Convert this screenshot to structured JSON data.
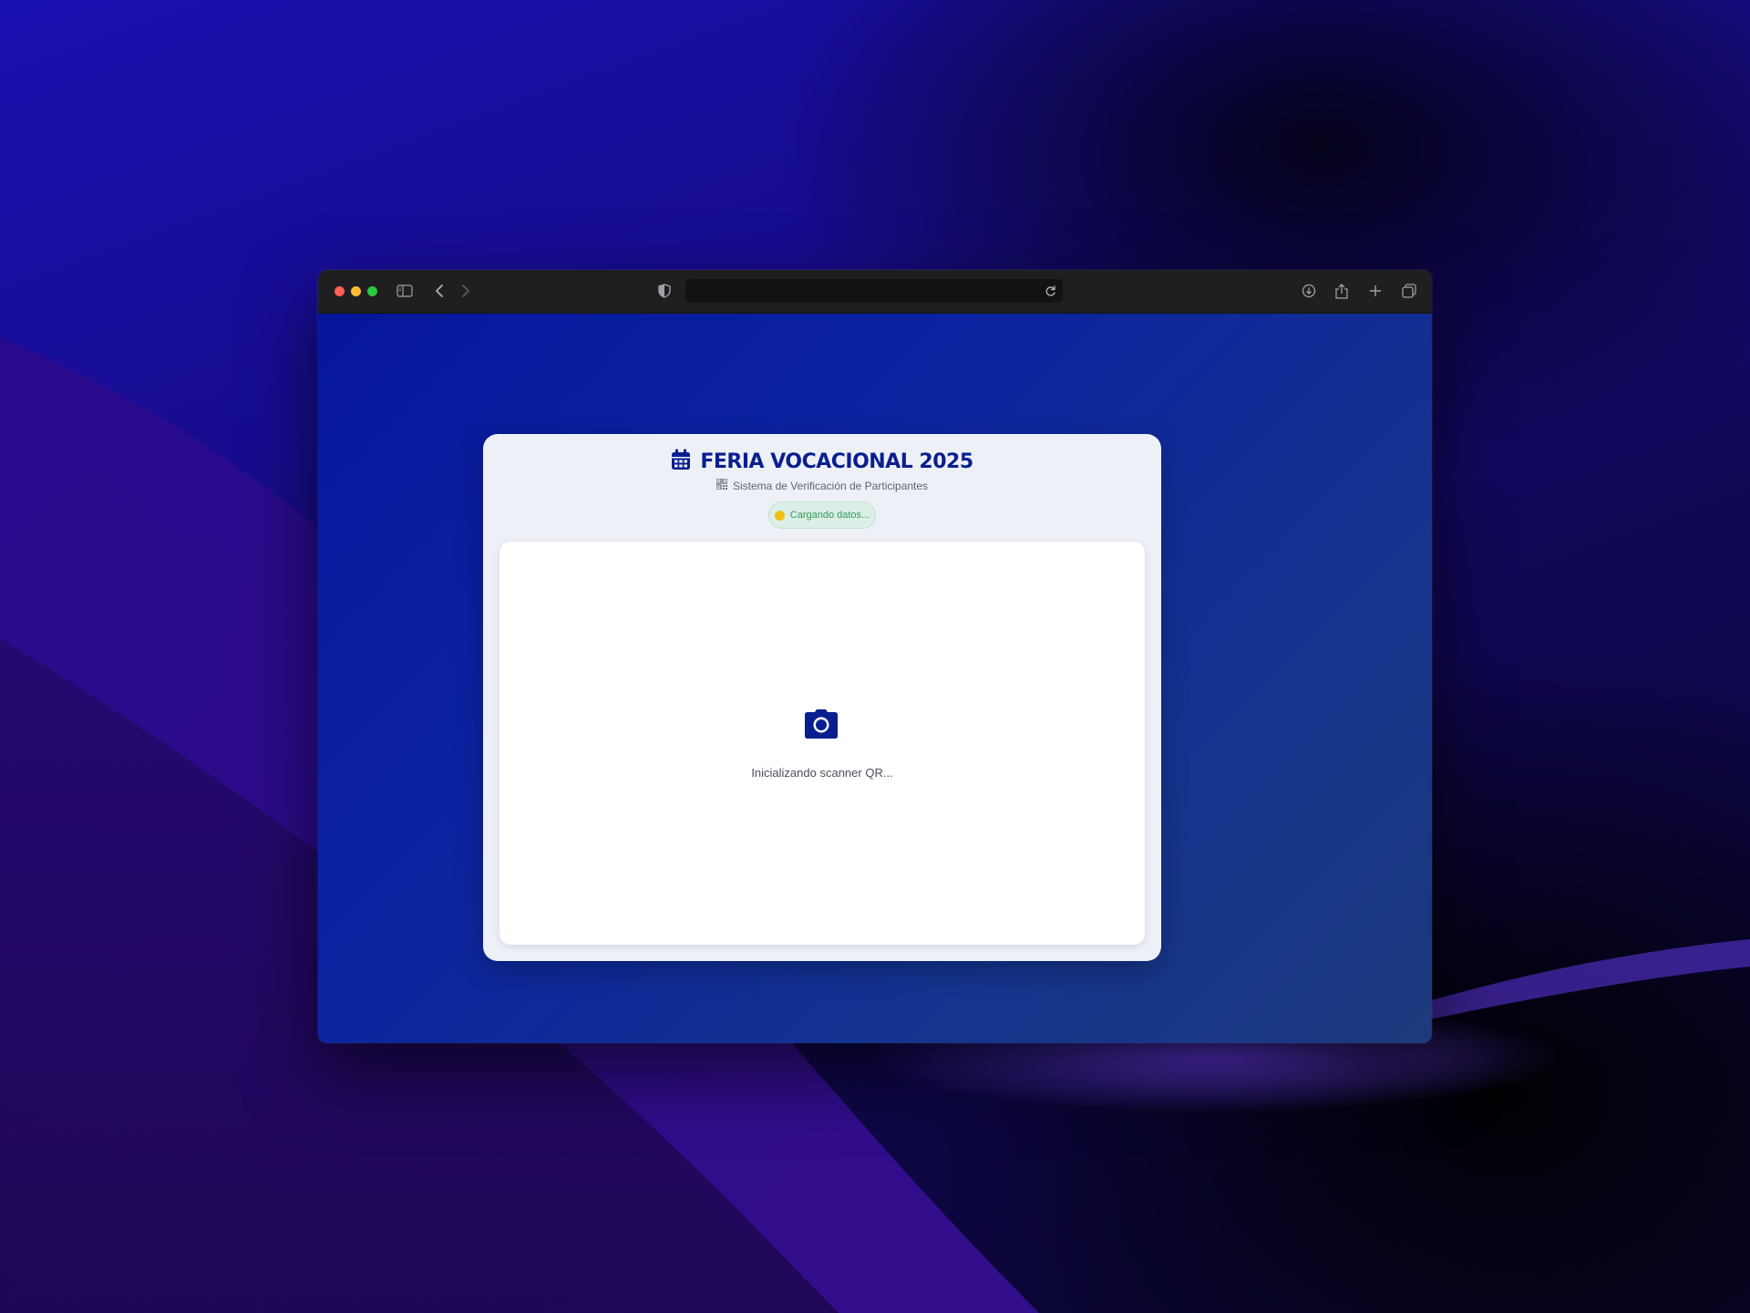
{
  "browser": {
    "address": "",
    "icons": {
      "sidebar": "sidebar-icon",
      "back": "chevron-left-icon",
      "forward": "chevron-right-icon",
      "privacy": "shield-icon",
      "reload": "reload-icon",
      "download": "download-icon",
      "share": "share-icon",
      "new_tab": "plus-icon",
      "tabs": "tab-overview-icon"
    }
  },
  "app": {
    "title": "FERIA VOCACIONAL 2025",
    "subtitle": "Sistema de Verificación de Participantes",
    "status": "Cargando datos...",
    "scanner_message": "Inicializando scanner QR..."
  },
  "colors": {
    "brand": "#0a1f8f",
    "status_dot": "#f2c012",
    "status_text": "#2f9a57",
    "background": "#06169c"
  }
}
